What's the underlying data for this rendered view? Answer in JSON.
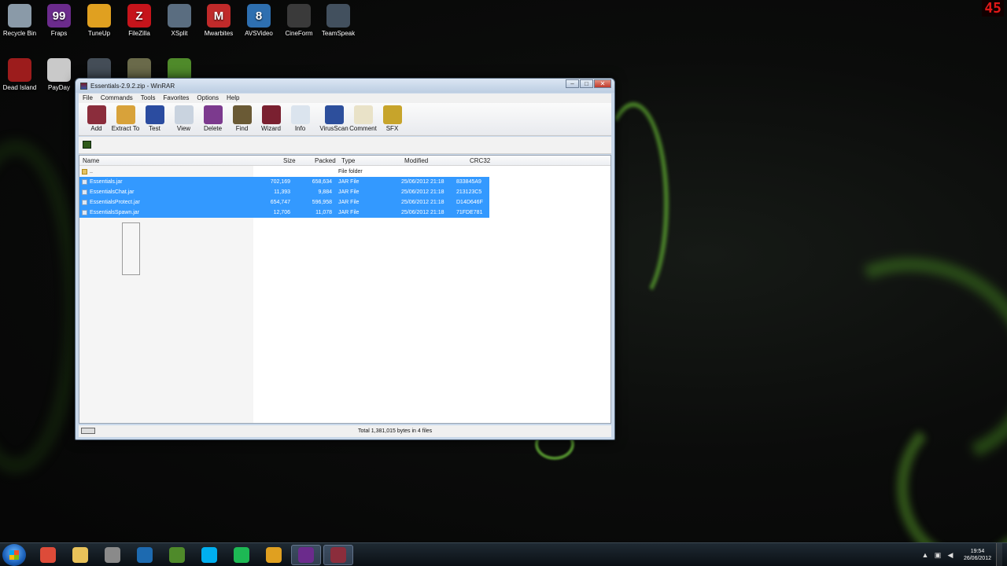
{
  "overlay": {
    "fps": "45"
  },
  "desktop_icons": [
    {
      "label": "Recycle Bin",
      "icon": "recycle-bin-icon",
      "color": "#8a9aa8"
    },
    {
      "label": "Fraps",
      "icon": "fraps-icon",
      "color": "#6b2b8c",
      "glyph": "99"
    },
    {
      "label": "TuneUp",
      "icon": "tuneup-icon",
      "color": "#e0a020"
    },
    {
      "label": "FileZilla",
      "icon": "filezilla-icon",
      "color": "#c6141b",
      "glyph": "Z"
    },
    {
      "label": "XSplit",
      "icon": "xsplit-icon",
      "color": "#5a6d80"
    },
    {
      "label": "Mwarbites",
      "icon": "malwarebytes-icon",
      "color": "#c02a2a",
      "glyph": "M"
    },
    {
      "label": "AVSVideo",
      "icon": "avs-video-icon",
      "color": "#2e6fb0",
      "glyph": "8"
    },
    {
      "label": "CineForm",
      "icon": "cineform-icon",
      "color": "#3a3a3a"
    },
    {
      "label": "TeamSpeak",
      "icon": "teamspeak-icon",
      "color": "#42505e"
    },
    {
      "label": "Dead Island",
      "icon": "dead-island-icon",
      "color": "#9c1c1c"
    },
    {
      "label": "PayDay",
      "icon": "payday-icon",
      "color": "#c9c9c9"
    },
    {
      "label": "",
      "icon": "steam-icon",
      "color": "#444d57"
    },
    {
      "label": "",
      "icon": "game-icon",
      "color": "#6a6a4a"
    },
    {
      "label": "",
      "icon": "minecraft-icon",
      "color": "#4f8a2a"
    }
  ],
  "window": {
    "title": "Essentials-2.9.2.zip - WinRAR",
    "menu": [
      "File",
      "Commands",
      "Tools",
      "Favorites",
      "Options",
      "Help"
    ],
    "toolbar": [
      {
        "label": "Add",
        "icon": "add-archive-icon",
        "color": "#8b2d3c"
      },
      {
        "label": "Extract To",
        "icon": "extract-to-icon",
        "color": "#d8a23a"
      },
      {
        "label": "Test",
        "icon": "test-icon",
        "color": "#2b4ca0"
      },
      {
        "label": "View",
        "icon": "view-icon",
        "color": "#c9d3df"
      },
      {
        "label": "Delete",
        "icon": "delete-icon",
        "color": "#7c3a8e"
      },
      {
        "label": "Find",
        "icon": "find-icon",
        "color": "#6a5a35"
      },
      {
        "label": "Wizard",
        "icon": "wizard-icon",
        "color": "#7a2030"
      },
      {
        "label": "Info",
        "icon": "info-icon",
        "color": "#dbe4ee"
      },
      {
        "label": "VirusScan",
        "icon": "virus-scan-icon",
        "color": "#2d4f9c"
      },
      {
        "label": "Comment",
        "icon": "comment-icon",
        "color": "#e9e2c8"
      },
      {
        "label": "SFX",
        "icon": "sfx-icon",
        "color": "#c7a42b"
      }
    ],
    "columns": {
      "name": "Name",
      "size": "Size",
      "packed": "Packed",
      "type": "Type",
      "modified": "Modified",
      "crc": "CRC32"
    },
    "parent_row": {
      "name": "..",
      "type": "File folder"
    },
    "files": [
      {
        "name": "Essentials.jar",
        "size": "702,169",
        "packed": "658,634",
        "type": "JAR File",
        "modified": "25/06/2012 21:18",
        "crc": "833845A9"
      },
      {
        "name": "EssentialsChat.jar",
        "size": "11,393",
        "packed": "9,884",
        "type": "JAR File",
        "modified": "25/06/2012 21:18",
        "crc": "213123C5"
      },
      {
        "name": "EssentialsProtect.jar",
        "size": "654,747",
        "packed": "596,958",
        "type": "JAR File",
        "modified": "25/06/2012 21:18",
        "crc": "D14D646F"
      },
      {
        "name": "EssentialsSpawn.jar",
        "size": "12,706",
        "packed": "11,078",
        "type": "JAR File",
        "modified": "25/06/2012 21:18",
        "crc": "71FDE781"
      }
    ],
    "status": "Total 1,381,015 bytes in 4 files"
  },
  "taskbar": {
    "apps": [
      {
        "icon": "chrome-icon",
        "color": "#dd4b39"
      },
      {
        "icon": "explorer-icon",
        "color": "#e8c25a"
      },
      {
        "icon": "settings-icon",
        "color": "#8a8a8a"
      },
      {
        "icon": "globe-icon",
        "color": "#1d6ab0"
      },
      {
        "icon": "minecraft-icon",
        "color": "#4f8a2a"
      },
      {
        "icon": "skype-icon",
        "color": "#00aff0"
      },
      {
        "icon": "spotify-icon",
        "color": "#1db954"
      },
      {
        "icon": "folder-icon",
        "color": "#e0a020"
      },
      {
        "icon": "fraps-icon",
        "color": "#6b2b8c",
        "active": true
      },
      {
        "icon": "winrar-icon",
        "color": "#8b2d3c",
        "active": true
      }
    ],
    "time": "19:54",
    "date": "26/06/2012"
  }
}
